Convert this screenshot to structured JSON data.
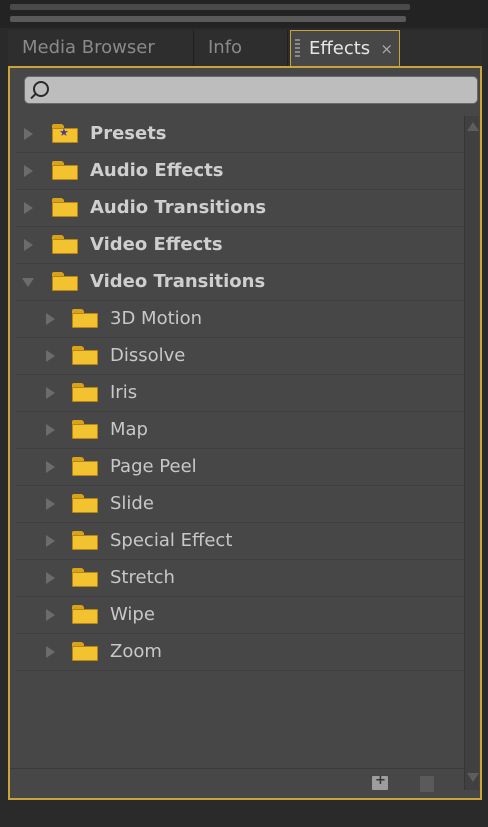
{
  "tabs": [
    {
      "label": "Media Browser"
    },
    {
      "label": "Info"
    },
    {
      "label": "Effects",
      "close": "×"
    }
  ],
  "search": {
    "value": "",
    "placeholder": ""
  },
  "tree": [
    {
      "label": "Presets",
      "icon": "preset-folder-icon",
      "expanded": false,
      "level": 0
    },
    {
      "label": "Audio Effects",
      "icon": "folder-icon",
      "expanded": false,
      "level": 0
    },
    {
      "label": "Audio Transitions",
      "icon": "folder-icon",
      "expanded": false,
      "level": 0
    },
    {
      "label": "Video Effects",
      "icon": "folder-icon",
      "expanded": false,
      "level": 0
    },
    {
      "label": "Video Transitions",
      "icon": "folder-icon",
      "expanded": true,
      "level": 0
    },
    {
      "label": "3D Motion",
      "icon": "folder-icon",
      "expanded": false,
      "level": 1
    },
    {
      "label": "Dissolve",
      "icon": "folder-icon",
      "expanded": false,
      "level": 1
    },
    {
      "label": "Iris",
      "icon": "folder-icon",
      "expanded": false,
      "level": 1
    },
    {
      "label": "Map",
      "icon": "folder-icon",
      "expanded": false,
      "level": 1
    },
    {
      "label": "Page Peel",
      "icon": "folder-icon",
      "expanded": false,
      "level": 1
    },
    {
      "label": "Slide",
      "icon": "folder-icon",
      "expanded": false,
      "level": 1
    },
    {
      "label": "Special Effect",
      "icon": "folder-icon",
      "expanded": false,
      "level": 1
    },
    {
      "label": "Stretch",
      "icon": "folder-icon",
      "expanded": false,
      "level": 1
    },
    {
      "label": "Wipe",
      "icon": "folder-icon",
      "expanded": false,
      "level": 1
    },
    {
      "label": "Zoom",
      "icon": "folder-icon",
      "expanded": false,
      "level": 1
    }
  ],
  "colors": {
    "accent": "#c9a43a",
    "panel_bg": "#474747",
    "folder": "#f2c230"
  }
}
